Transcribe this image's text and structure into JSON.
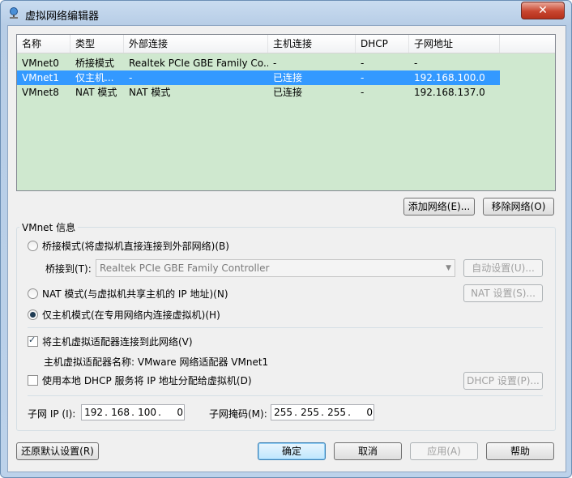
{
  "window": {
    "title": "虚拟网络编辑器",
    "close_label": "✕"
  },
  "table": {
    "columns": [
      "名称",
      "类型",
      "外部连接",
      "主机连接",
      "DHCP",
      "子网地址"
    ],
    "rows": [
      [
        "VMnet0",
        "桥接模式",
        "Realtek PCIe GBE Family Co...",
        "-",
        "-",
        "-"
      ],
      [
        "VMnet1",
        "仅主机...",
        "-",
        "已连接",
        "-",
        "192.168.100.0"
      ],
      [
        "VMnet8",
        "NAT 模式",
        "NAT 模式",
        "已连接",
        "-",
        "192.168.137.0"
      ]
    ],
    "selected_row": 1
  },
  "buttons": {
    "add_network": "添加网络(E)...",
    "remove_network": "移除网络(O)",
    "auto_settings": "自动设置(U)...",
    "nat_settings": "NAT 设置(S)...",
    "dhcp_settings": "DHCP 设置(P)...",
    "restore_defaults": "还原默认设置(R)",
    "ok": "确定",
    "cancel": "取消",
    "apply": "应用(A)",
    "help": "帮助"
  },
  "vmnet_info": {
    "group_label": "VMnet 信息",
    "bridged_label": "桥接模式(将虚拟机直接连接到外部网络)(B)",
    "bridged_to_label": "桥接到(T):",
    "bridged_to_value": "Realtek PCIe GBE Family Controller",
    "nat_label": "NAT 模式(与虚拟机共享主机的 IP 地址)(N)",
    "hostonly_label": "仅主机模式(在专用网络内连接虚拟机)(H)",
    "selected_mode": "hostonly",
    "connect_adapter_label": "将主机虚拟适配器连接到此网络(V)",
    "connect_adapter_checked": true,
    "adapter_name_text": "主机虚拟适配器名称: VMware 网络适配器 VMnet1",
    "dhcp_label": "使用本地 DHCP 服务将 IP 地址分配给虚拟机(D)",
    "dhcp_checked": false,
    "subnet_ip_label": "子网 IP (I):",
    "subnet_ip": [
      "192",
      "168",
      "100",
      "0"
    ],
    "subnet_mask_label": "子网掩码(M):",
    "subnet_mask": [
      "255",
      "255",
      "255",
      "0"
    ]
  },
  "colors": {
    "grid_bg": "#cfe8cf",
    "selection": "#3399ff"
  }
}
